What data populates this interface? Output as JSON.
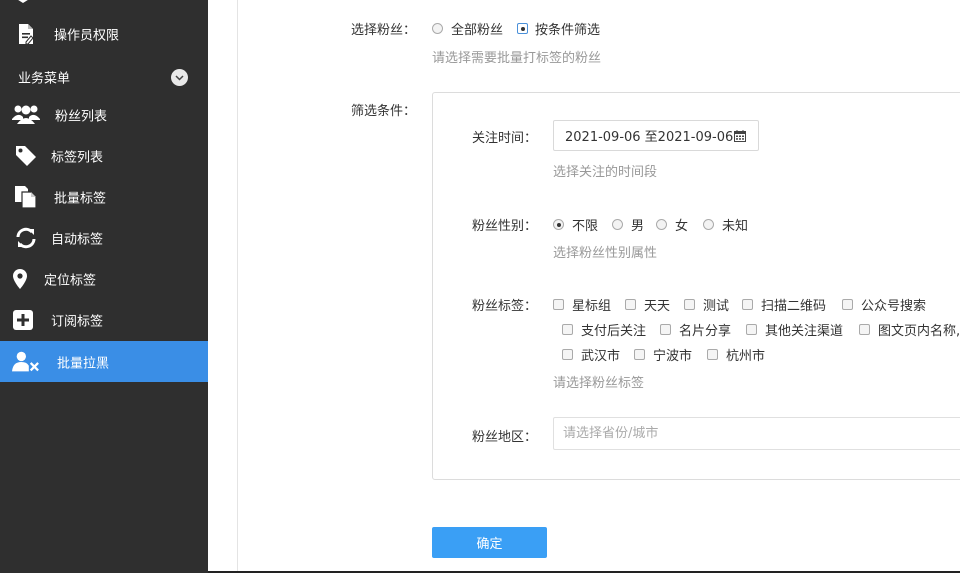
{
  "sidebar": {
    "items_top": [
      {
        "label": "操作员权限",
        "icon": "document-edit-icon"
      }
    ],
    "section": {
      "label": "业务菜单",
      "icon": "chevron-down-icon"
    },
    "items": [
      {
        "label": "粉丝列表",
        "icon": "users-icon"
      },
      {
        "label": "标签列表",
        "icon": "tag-icon"
      },
      {
        "label": "批量标签",
        "icon": "documents-icon"
      },
      {
        "label": "自动标签",
        "icon": "refresh-icon"
      },
      {
        "label": "定位标签",
        "icon": "map-pin-icon"
      },
      {
        "label": "订阅标签",
        "icon": "plus-square-icon"
      },
      {
        "label": "批量拉黑",
        "icon": "user-remove-icon",
        "active": true
      }
    ],
    "active_color": "#3a8ee6",
    "bg_color": "#2f2f2f"
  },
  "form": {
    "select_fans": {
      "label": "选择粉丝：",
      "options": [
        "全部粉丝",
        "按条件筛选"
      ],
      "selected": "按条件筛选",
      "hint": "请选择需要批量打标签的粉丝"
    },
    "filter_label": "筛选条件：",
    "follow_time": {
      "label": "关注时间：",
      "value": "2021-09-06 至2021-09-06",
      "hint": "选择关注的时间段"
    },
    "gender": {
      "label": "粉丝性别：",
      "options": [
        "不限",
        "男",
        "女",
        "未知"
      ],
      "selected": "不限",
      "hint": "选择粉丝性别属性"
    },
    "tags": {
      "label": "粉丝标签：",
      "rows": [
        [
          "星标组",
          "天天",
          "测试",
          "扫描二维码",
          "公众号搜索"
        ],
        [
          "支付后关注",
          "名片分享",
          "其他关注渠道",
          "图文页内名称,"
        ],
        [
          "武汉市",
          "宁波市",
          "杭州市"
        ]
      ],
      "hint": "请选择粉丝标签"
    },
    "region": {
      "label": "粉丝地区：",
      "placeholder": "请选择省份/城市",
      "value": ""
    },
    "submit_label": "确定",
    "accent_color": "#3a9ff5"
  }
}
